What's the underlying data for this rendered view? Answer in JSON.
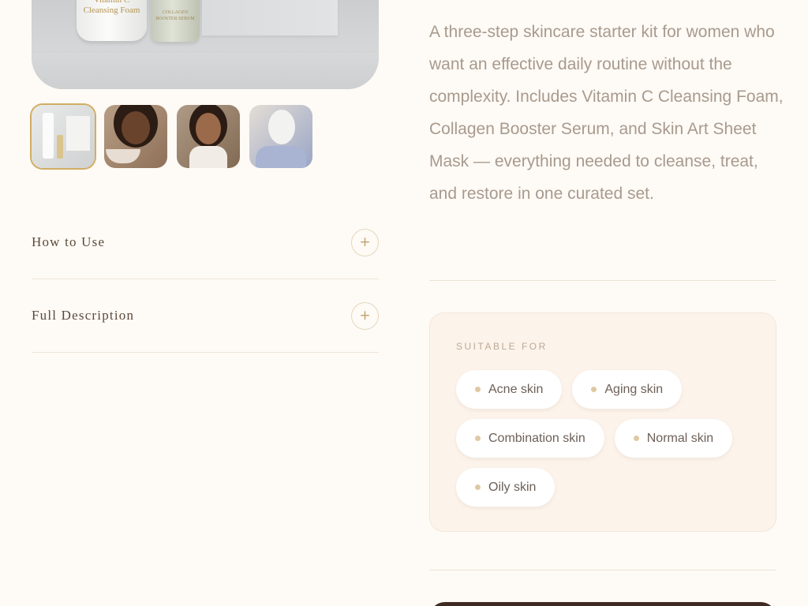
{
  "hero": {
    "foam_label": "Vitamin C\nCleansing Foam",
    "serum_label": "COLLAGEN\nBOOSTER SERUM"
  },
  "thumbnails": [
    {
      "name": "kit-photo",
      "active": true
    },
    {
      "name": "cleansing-photo",
      "active": false
    },
    {
      "name": "serum-photo",
      "active": false
    },
    {
      "name": "mask-photo",
      "active": false
    }
  ],
  "accordion": [
    {
      "title": "How to Use",
      "icon": "plus-icon",
      "symbol": "+"
    },
    {
      "title": "Full Description",
      "icon": "plus-icon",
      "symbol": "+"
    }
  ],
  "description": "A three-step skincare starter kit for women who want an effective daily routine without the complexity. Includes Vitamin C Cleansing Foam, Collagen Booster Serum, and Skin Art Sheet Mask — everything needed to cleanse, treat, and restore in one curated set.",
  "suitable": {
    "heading": "SUITABLE FOR",
    "chips": [
      "Acne skin",
      "Aging skin",
      "Combination skin",
      "Normal skin",
      "Oily skin"
    ]
  },
  "colors": {
    "background": "#fefaf5",
    "accent_gold": "#d1ad64",
    "text_muted": "#a89a8e",
    "cta_dark": "#3e2a22"
  }
}
